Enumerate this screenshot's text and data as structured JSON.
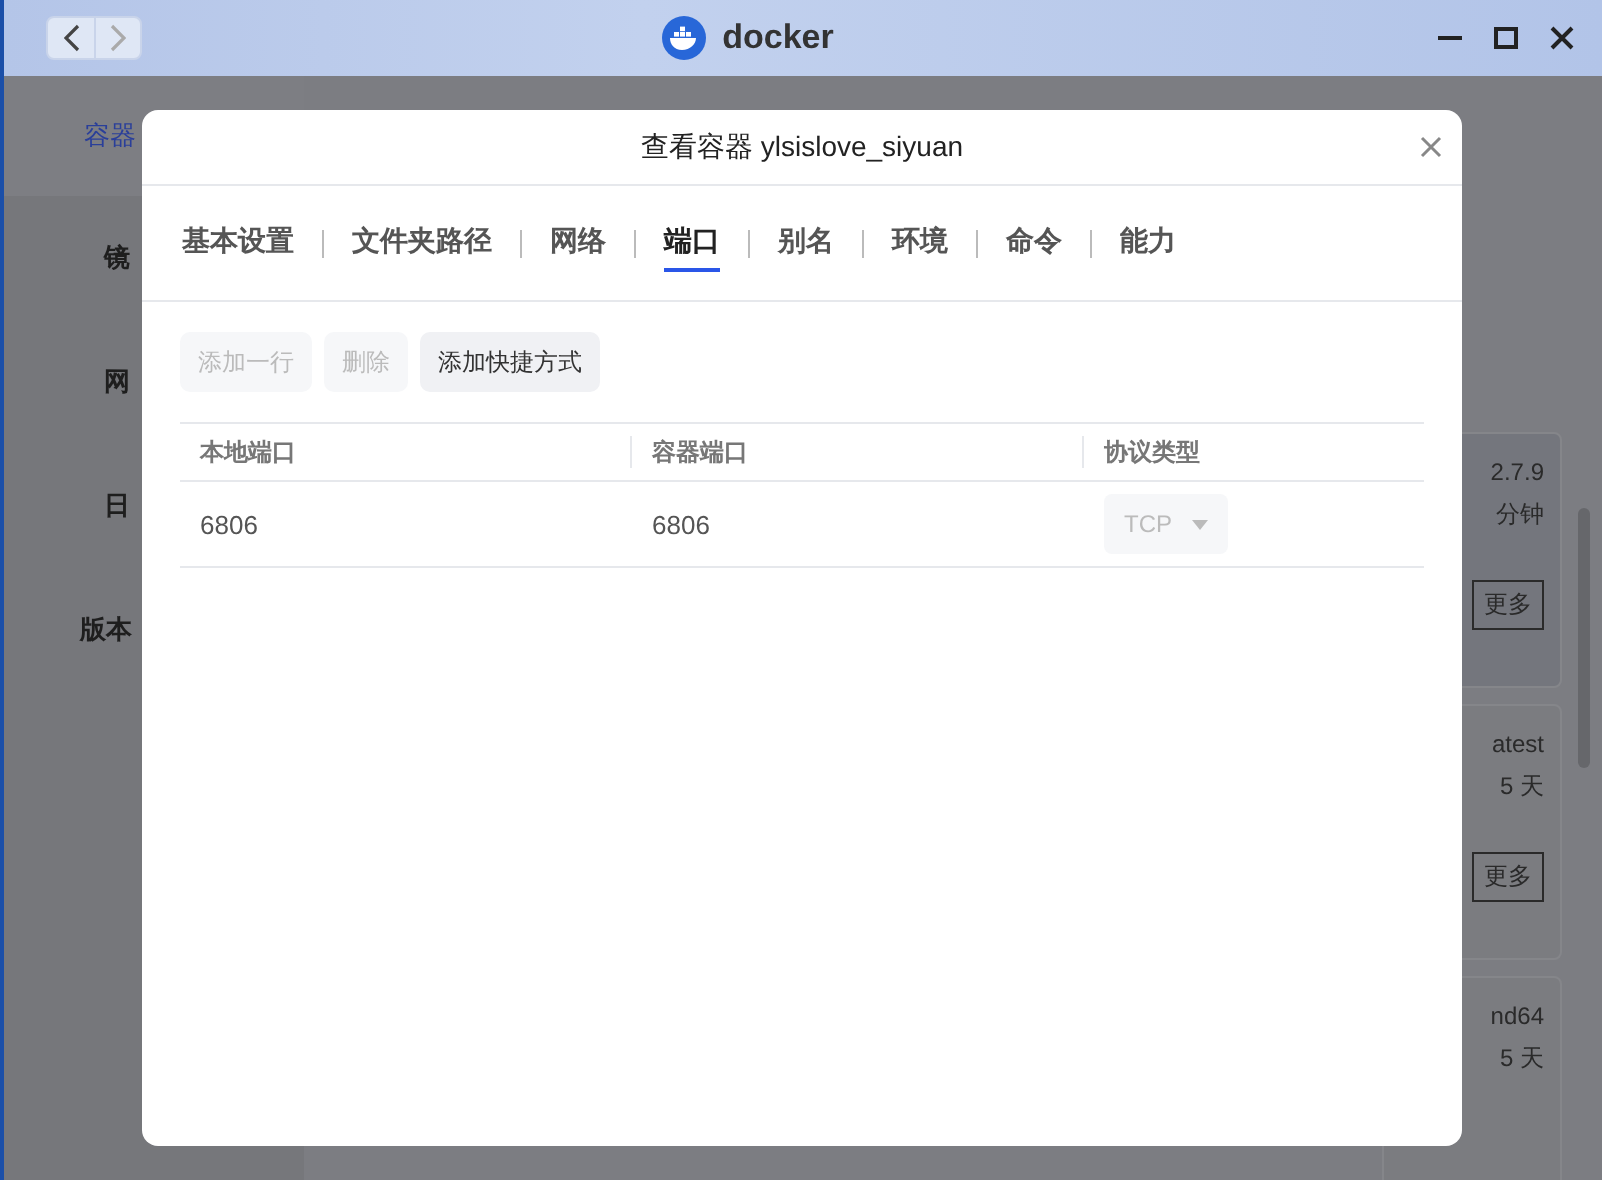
{
  "window": {
    "title": "docker"
  },
  "sidebar": {
    "items": [
      {
        "label": "容器",
        "selected": true
      },
      {
        "label": "镜",
        "selected": false
      },
      {
        "label": "网",
        "selected": false
      },
      {
        "label": "日",
        "selected": false
      },
      {
        "label": "版本",
        "selected": false
      }
    ]
  },
  "cards": [
    {
      "lines": [
        "2.7.9",
        "分钟"
      ],
      "button": "更多"
    },
    {
      "lines": [
        "atest",
        "5 天"
      ],
      "button": "更多"
    },
    {
      "lines": [
        "nd64",
        "5 天"
      ]
    }
  ],
  "dialog": {
    "title": "查看容器 ylsislove_siyuan",
    "tabs": [
      {
        "label": "基本设置",
        "selected": false
      },
      {
        "label": "文件夹路径",
        "selected": false
      },
      {
        "label": "网络",
        "selected": false
      },
      {
        "label": "端口",
        "selected": true
      },
      {
        "label": "别名",
        "selected": false
      },
      {
        "label": "环境",
        "selected": false
      },
      {
        "label": "命令",
        "selected": false
      },
      {
        "label": "能力",
        "selected": false
      }
    ],
    "buttons": [
      {
        "label": "添加一行",
        "disabled": true
      },
      {
        "label": "删除",
        "disabled": true
      },
      {
        "label": "添加快捷方式",
        "disabled": false
      }
    ],
    "table": {
      "columns": [
        "本地端口",
        "容器端口",
        "协议类型"
      ],
      "rows": [
        {
          "local": "6806",
          "container": "6806",
          "protocol": "TCP",
          "disabled": true
        }
      ]
    }
  }
}
